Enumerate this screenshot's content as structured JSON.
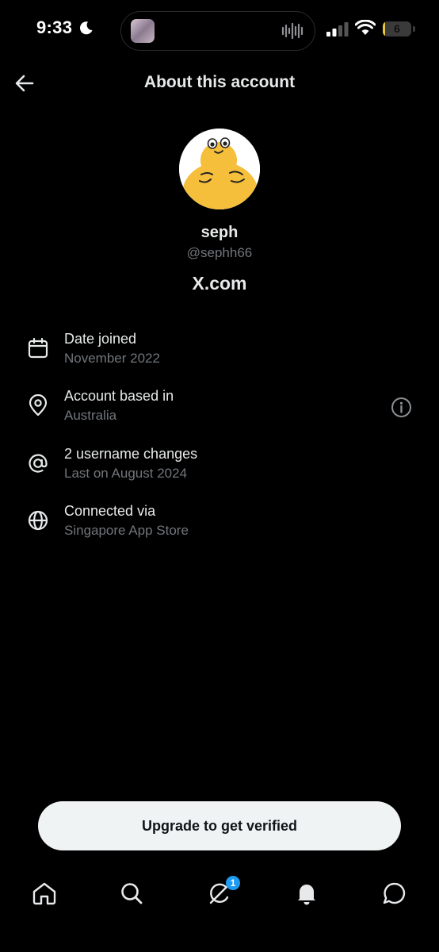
{
  "status_bar": {
    "time": "9:33",
    "battery_level": "6",
    "battery_fraction": 0.06,
    "icons": [
      "moon-icon",
      "now-playing-thumbnail",
      "audio-waveform-icon",
      "cellular-signal-icon",
      "wifi-icon",
      "battery-icon"
    ]
  },
  "header": {
    "title": "About this account",
    "back_icon": "arrow-left-icon"
  },
  "profile": {
    "display_name": "seph",
    "handle": "@sephh66",
    "site": "X.com",
    "avatar": "yellow-creature-avatar"
  },
  "details": [
    {
      "icon": "calendar-icon",
      "label": "Date joined",
      "value": "November 2022"
    },
    {
      "icon": "location-pin-icon",
      "label": "Account based in",
      "value": "Australia",
      "action_icon": "info-circle-icon"
    },
    {
      "icon": "at-sign-icon",
      "label": "2 username changes",
      "value": "Last on August 2024"
    },
    {
      "icon": "globe-icon",
      "label": "Connected via",
      "value": "Singapore App Store"
    }
  ],
  "cta": {
    "label": "Upgrade to get verified"
  },
  "tab_bar": {
    "tabs": [
      "home-icon",
      "search-icon",
      "grok-icon",
      "notifications-bell-icon",
      "messages-icon"
    ],
    "grok_badge": "1"
  },
  "colors": {
    "background": "#000000",
    "primary_text": "#e7e9ea",
    "secondary_text": "#71767b",
    "accent": "#1d9bf0",
    "button_bg": "#eff3f4",
    "avatar_yellow": "#f5be3b"
  }
}
